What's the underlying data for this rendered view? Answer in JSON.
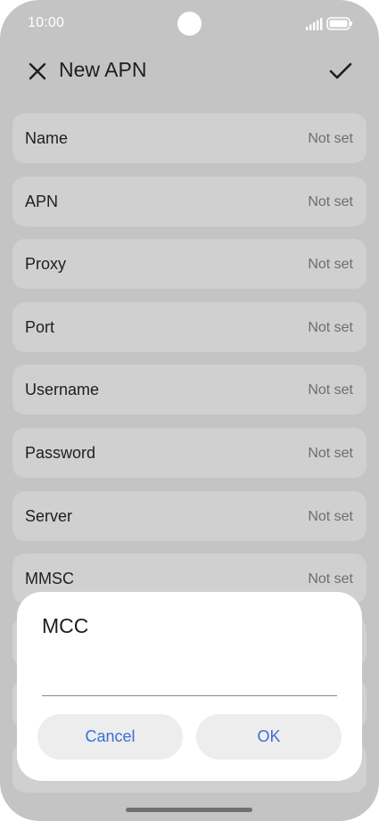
{
  "status_bar": {
    "time": "10:00",
    "icons": [
      "signal-icon",
      "battery-icon"
    ]
  },
  "app_bar": {
    "title": "New APN",
    "icons": [
      "close-icon",
      "check-icon"
    ]
  },
  "settings": [
    {
      "label": "Name",
      "value": "Not set"
    },
    {
      "label": "APN",
      "value": "Not set"
    },
    {
      "label": "Proxy",
      "value": "Not set"
    },
    {
      "label": "Port",
      "value": "Not set"
    },
    {
      "label": "Username",
      "value": "Not set"
    },
    {
      "label": "Password",
      "value": "Not set"
    },
    {
      "label": "Server",
      "value": "Not set"
    },
    {
      "label": "MMSC",
      "value": "Not set"
    }
  ],
  "dialog": {
    "title": "MCC",
    "input_value": "",
    "cancel_label": "Cancel",
    "ok_label": "OK"
  },
  "colors": {
    "background": "#c4c4c4",
    "card": "#d0d0d0",
    "accent": "#3a6fd8",
    "dialog": "#ffffff"
  }
}
